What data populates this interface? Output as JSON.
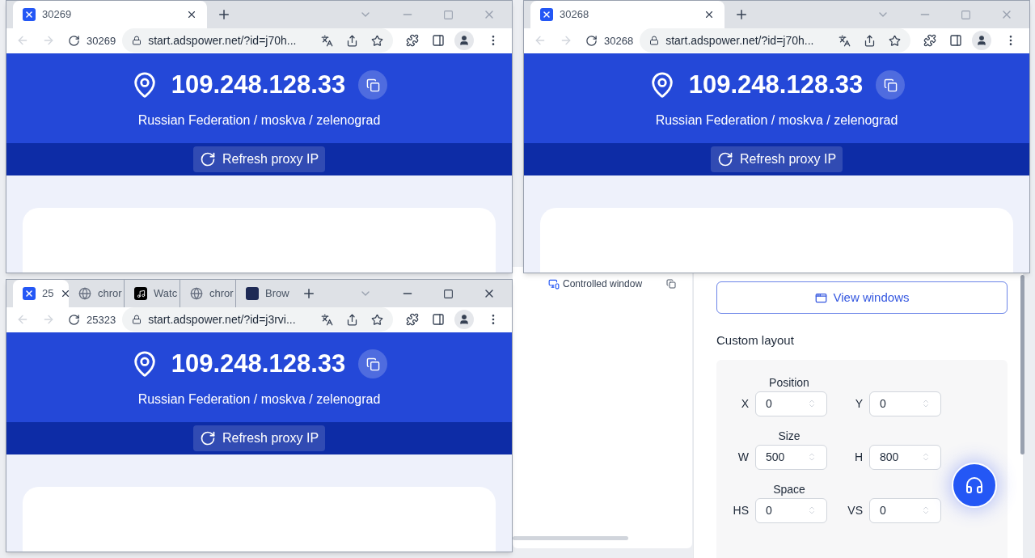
{
  "windows": [
    {
      "tabs": [
        {
          "title": "30269",
          "kind": "app",
          "selected": true
        }
      ],
      "profile": "30269",
      "url": "start.adspower.net/?id=j70h...",
      "ip": "109.248.128.33",
      "location": "Russian Federation / moskva / zelenograd",
      "refresh": "Refresh proxy IP"
    },
    {
      "tabs": [
        {
          "title": "30268",
          "kind": "app",
          "selected": true
        }
      ],
      "profile": "30268",
      "url": "start.adspower.net/?id=j70h...",
      "ip": "109.248.128.33",
      "location": "Russian Federation / moskva / zelenograd",
      "refresh": "Refresh proxy IP"
    },
    {
      "tabs": [
        {
          "title": "25",
          "kind": "app",
          "selected": true
        },
        {
          "title": "chror",
          "kind": "globe",
          "selected": false
        },
        {
          "title": "Watc",
          "kind": "note",
          "selected": false
        },
        {
          "title": "chror",
          "kind": "globe",
          "selected": false
        },
        {
          "title": "Brow",
          "kind": "dark",
          "selected": false
        }
      ],
      "profile": "25323",
      "url": "start.adspower.net/?id=j3rvi...",
      "ip": "109.248.128.33",
      "location": "Russian Federation / moskva / zelenograd",
      "refresh": "Refresh proxy IP"
    }
  ],
  "background": {
    "list_item": "Controlled window",
    "view_button": "View windows",
    "section_title": "Custom layout",
    "groups": [
      {
        "title": "Position",
        "fields": [
          {
            "label": "X",
            "value": "0"
          },
          {
            "label": "Y",
            "value": "0"
          }
        ]
      },
      {
        "title": "Size",
        "fields": [
          {
            "label": "W",
            "value": "500"
          },
          {
            "label": "H",
            "value": "800"
          }
        ]
      },
      {
        "title": "Space",
        "fields": [
          {
            "label": "HS",
            "value": "0"
          },
          {
            "label": "VS",
            "value": "0"
          }
        ]
      }
    ]
  }
}
